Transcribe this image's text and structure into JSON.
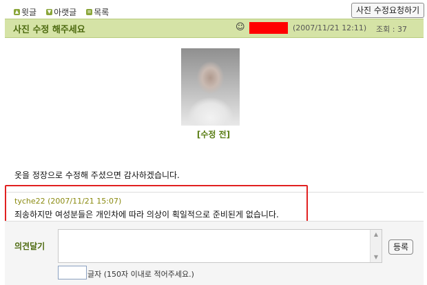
{
  "nav": {
    "prev_label": "윗글",
    "next_label": "아랫글",
    "list_label": "목록"
  },
  "request_button": "사진 수정요청하기",
  "post": {
    "title": "사진 수정 해주세요",
    "date": "(2007/11/21 12:11)",
    "views": "조회 : 37",
    "photo_caption": "[수정 전]",
    "body": "옷을 정장으로 수정해 주셨으면 감사하겠습니다."
  },
  "comment": {
    "meta": "tyche22 (2007/11/21 15:07)",
    "text": "죄송하지만 여성분들은 개인차에 따라 의상이 획일적으로 준비된게 없습니다."
  },
  "form": {
    "label": "의견달기",
    "submit_label": "등록",
    "count_note": "글자 (150자 이내로 적어주세요.)"
  },
  "colors": {
    "title_bar": "#d5e3a6",
    "accent_green": "#4d6a10",
    "highlight_red": "#e12020",
    "redaction": "#ff0000"
  }
}
